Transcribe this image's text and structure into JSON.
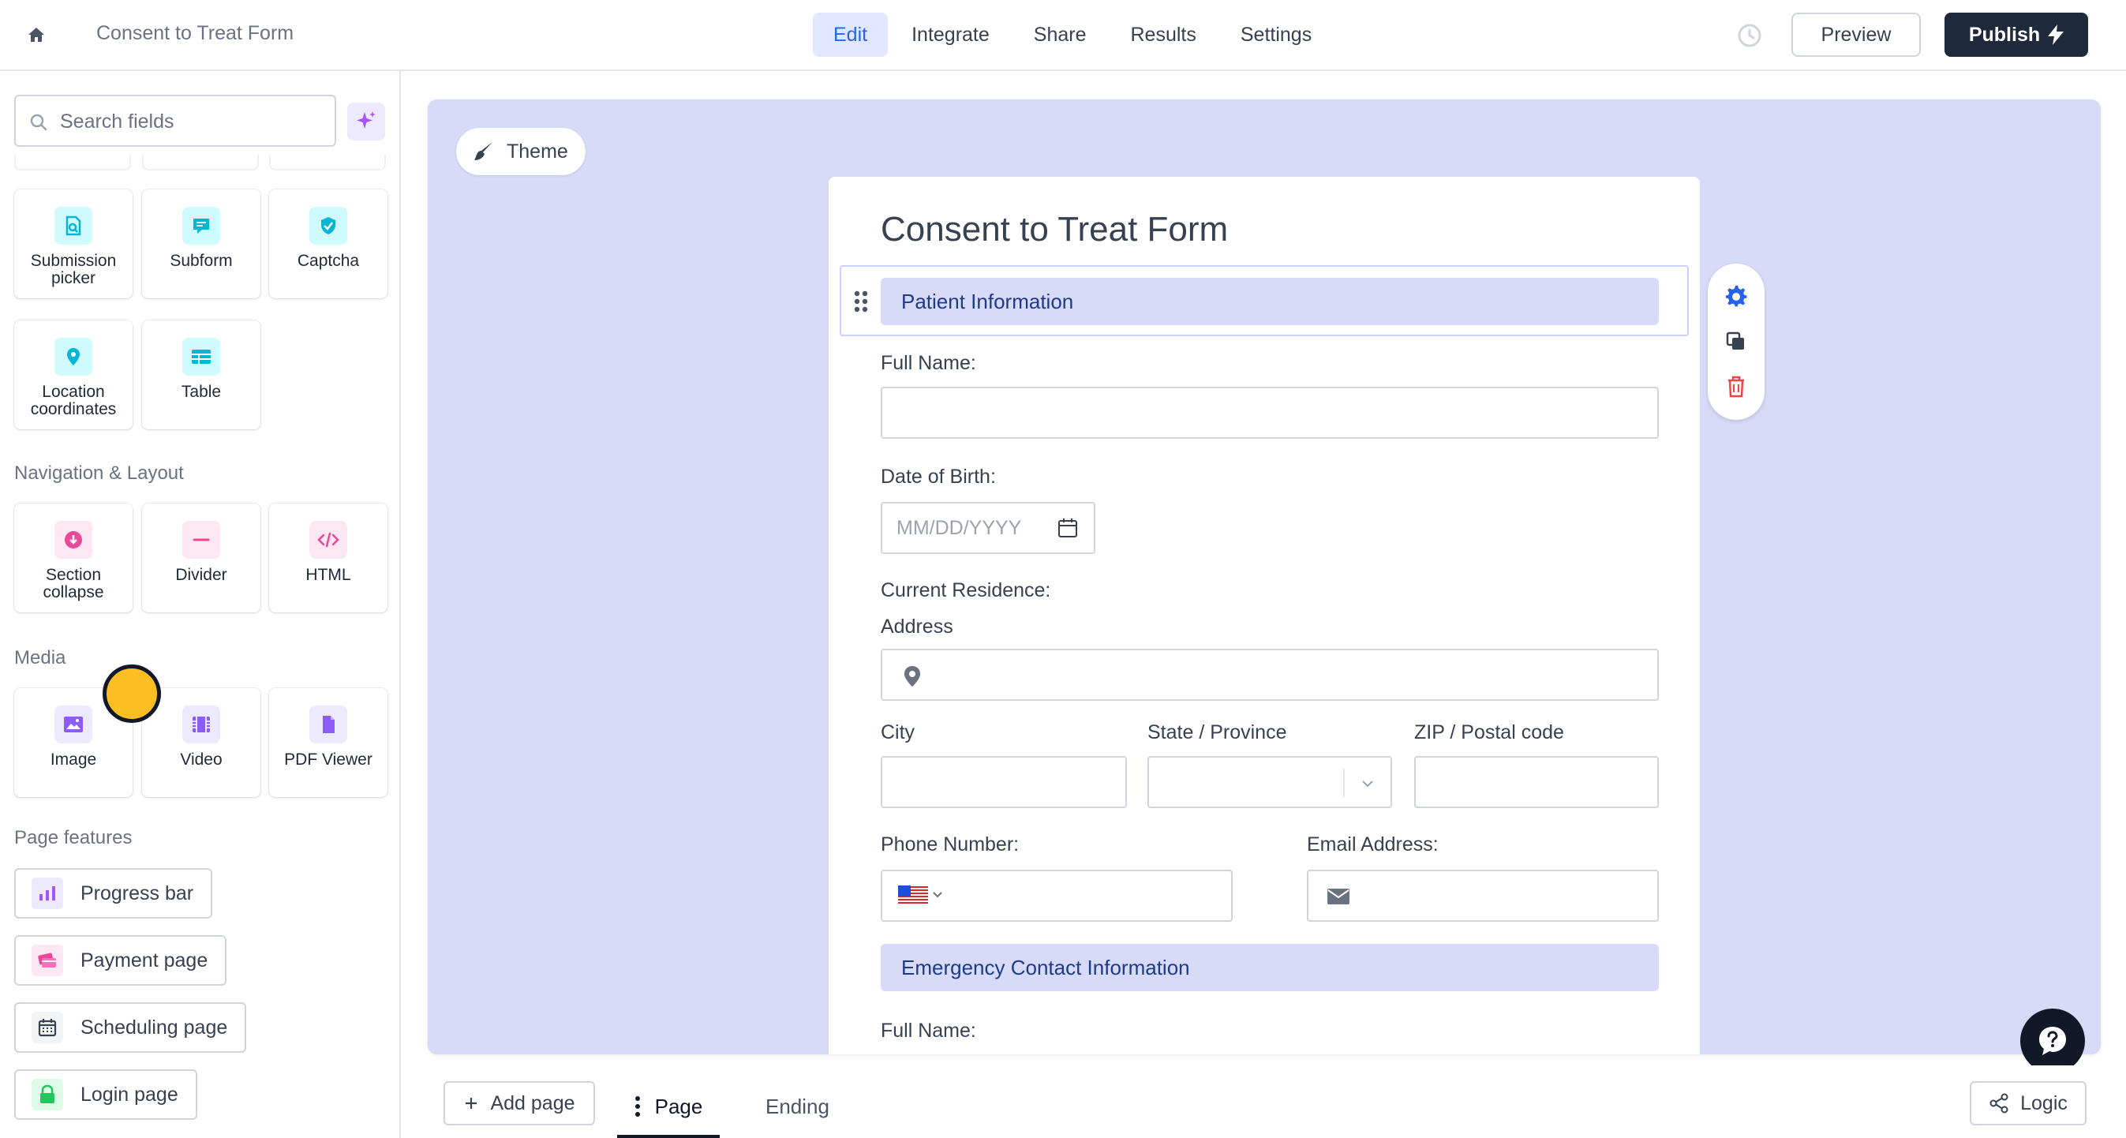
{
  "topbar": {
    "form_name": "Consent to Treat Form",
    "nav": [
      "Edit",
      "Integrate",
      "Share",
      "Results",
      "Settings"
    ],
    "active_nav": "Edit",
    "preview_label": "Preview",
    "publish_label": "Publish"
  },
  "sidebar": {
    "search_placeholder": "Search fields",
    "advanced_tiles": [
      {
        "label": "Submission picker",
        "icon": "submission-picker-icon"
      },
      {
        "label": "Subform",
        "icon": "subform-icon"
      },
      {
        "label": "Captcha",
        "icon": "captcha-icon"
      },
      {
        "label": "Location coordinates",
        "icon": "location-pin-icon"
      },
      {
        "label": "Table",
        "icon": "table-icon"
      }
    ],
    "nav_layout_heading": "Navigation & Layout",
    "nav_layout_tiles": [
      {
        "label": "Section collapse",
        "icon": "section-collapse-icon"
      },
      {
        "label": "Divider",
        "icon": "divider-icon"
      },
      {
        "label": "HTML",
        "icon": "html-code-icon"
      }
    ],
    "media_heading": "Media",
    "media_tiles": [
      {
        "label": "Image",
        "icon": "image-icon"
      },
      {
        "label": "Video",
        "icon": "video-icon"
      },
      {
        "label": "PDF Viewer",
        "icon": "pdf-icon"
      }
    ],
    "page_features_heading": "Page features",
    "page_features": [
      {
        "label": "Progress bar",
        "icon": "progress-bar-icon"
      },
      {
        "label": "Payment page",
        "icon": "payment-icon"
      },
      {
        "label": "Scheduling page",
        "icon": "calendar-icon"
      },
      {
        "label": "Login page",
        "icon": "lock-icon"
      }
    ]
  },
  "canvas": {
    "theme_label": "Theme",
    "form_title": "Consent to Treat Form",
    "section_patient": "Patient Information",
    "full_name_label": "Full Name:",
    "dob_label": "Date of Birth:",
    "dob_placeholder": "MM/DD/YYYY",
    "residence_label": "Current Residence:",
    "address_label": "Address",
    "city_label": "City",
    "state_label": "State / Province",
    "zip_label": "ZIP / Postal code",
    "phone_label": "Phone Number:",
    "email_label": "Email Address:",
    "section_emergency": "Emergency Contact Information",
    "emergency_full_name_label": "Full Name:"
  },
  "bottombar": {
    "add_page_label": "Add page",
    "page_tab_label": "Page",
    "ending_tab_label": "Ending",
    "logic_label": "Logic"
  },
  "colors": {
    "accent": "#2563eb",
    "canvas_bg": "#d8dbf7",
    "publish_bg": "#1e293b",
    "delete": "#ef4444"
  }
}
